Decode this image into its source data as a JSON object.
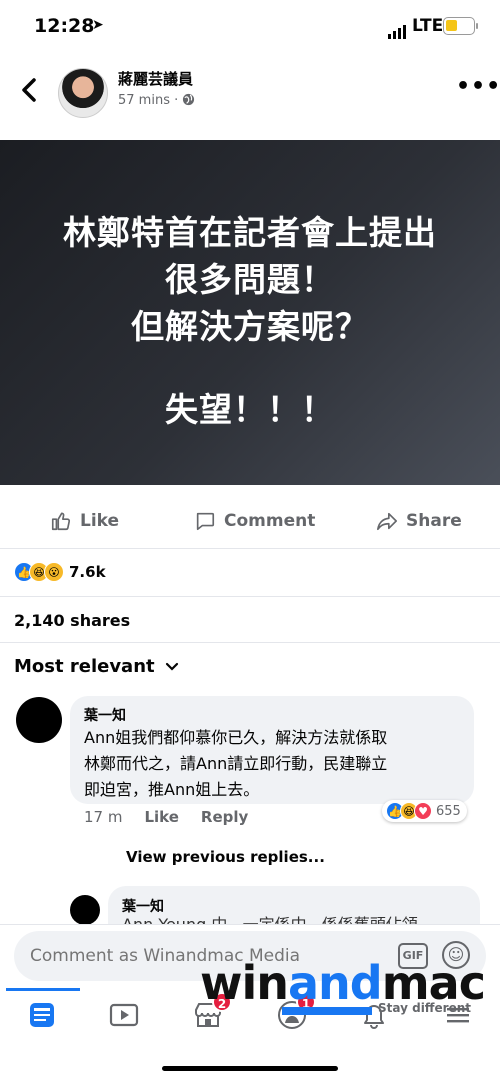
{
  "status_bar": {
    "time": "12:28",
    "network": "LTE",
    "battery_color": "#f5c518"
  },
  "header": {
    "author": "蔣麗芸議員",
    "time": "57 mins",
    "privacy_icon": "globe-icon"
  },
  "post_image": {
    "lines": [
      "林鄭特首在記者會上提出",
      "很多問題！",
      "但解決方案呢？",
      "失望！！！"
    ]
  },
  "actions": {
    "like": "Like",
    "comment": "Comment",
    "share": "Share"
  },
  "reactions": {
    "types": [
      "like",
      "haha",
      "wow"
    ],
    "count": "7.6k"
  },
  "shares": "2,140 shares",
  "sort": {
    "label": "Most relevant"
  },
  "comments": [
    {
      "name": "葉一知",
      "text_lines": [
        "Ann姐我們都仰慕你已久，解決方法就係取",
        "林鄭而代之，請Ann請立即行動，民建聯立",
        "即迫宮，推Ann姐上去。"
      ],
      "time": "17 m",
      "like": "Like",
      "reply": "Reply",
      "reaction_types": [
        "like",
        "haha",
        "love"
      ],
      "reaction_count": "655"
    }
  ],
  "view_previous": "View previous replies...",
  "reply": {
    "name": "葉一知",
    "text_partial": "Ann Yeung 中...一定係中...係係舊頭佔領"
  },
  "comment_input": {
    "placeholder": "Comment as Winandmac Media",
    "gif": "GIF"
  },
  "tabbar": {
    "tabs": [
      "news-feed",
      "watch",
      "marketplace",
      "groups",
      "notifications",
      "menu"
    ],
    "badges": {
      "marketplace": "2",
      "groups": "1"
    }
  },
  "watermark": {
    "win": "win",
    "and": "and",
    "mac": "mac",
    "tagline": "Stay different"
  },
  "colors": {
    "accent": "#1877f2",
    "badge": "#e41e3f",
    "gray": "#65676b"
  }
}
